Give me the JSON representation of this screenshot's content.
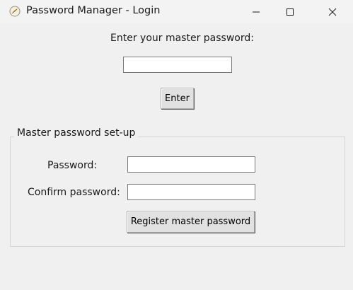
{
  "window": {
    "title": "Password Manager - Login",
    "icon": "feather-app-icon",
    "controls": {
      "minimize": "minimize-icon",
      "maximize": "maximize-icon",
      "close": "close-icon"
    }
  },
  "login": {
    "prompt": "Enter your master password:",
    "password_value": "",
    "enter_label": "Enter"
  },
  "setup": {
    "group_title": "Master password set-up",
    "password_label": "Password:",
    "password_value": "",
    "confirm_label": "Confirm password:",
    "confirm_value": "",
    "register_label": "Register master password"
  },
  "colors": {
    "window_bg": "#f0f0f0",
    "button_bg": "#e1e1e1",
    "entry_border": "#7a7a7a"
  }
}
